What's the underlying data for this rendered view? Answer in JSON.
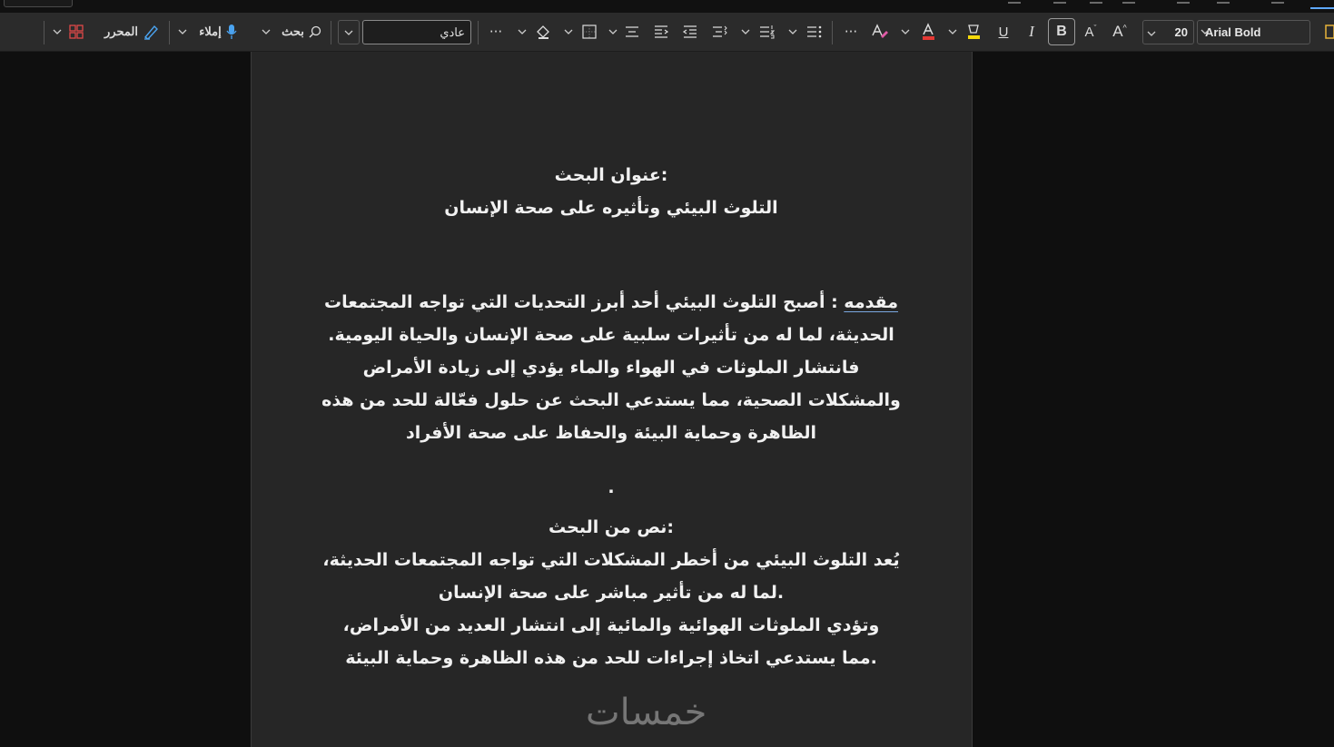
{
  "ribbon": {
    "font_name": "Arial Bold",
    "font_size": "20",
    "bold_label": "B",
    "italic_label": "I",
    "underline_label": "U",
    "style_value": "عادي",
    "search_label": "بحث",
    "dictate_label": "إملاء",
    "editor_label": "المحرر",
    "more_label": "···",
    "font_color": "#e53935",
    "highlight_color": "#f5d90a",
    "accent_color": "#5fa8ff"
  },
  "document": {
    "title_label": ":عنوان البحث",
    "title": "التلوث البيئي وتأثيره على صحة الإنسان",
    "intro_heading": "مقدمه",
    "intro_colon": " : ",
    "intro_lines": [
      "أصبح التلوث البيئي أحد أبرز التحديات التي تواجه المجتمعات",
      "الحديثة، لما له من تأثيرات سلبية على صحة الإنسان والحياة اليومية.",
      "فانتشار الملوثات في الهواء والماء يؤدي إلى زيادة الأمراض",
      "والمشكلات الصحية، مما يستدعي البحث عن حلول فعّالة للحد من هذه",
      "الظاهرة وحماية البيئة والحفاظ على صحة الأفراد"
    ],
    "dot": ".",
    "body_heading": ":نص من البحث",
    "body_lines": [
      "يُعد التلوث البيئي من أخطر المشكلات التي تواجه المجتمعات الحديثة،",
      ".لما له من تأثير مباشر على صحة الإنسان",
      "وتؤدي الملوثات الهوائية والمائية إلى انتشار العديد من الأمراض،",
      ".مما يستدعي اتخاذ إجراءات للحد من هذه الظاهرة وحماية البيئة"
    ]
  },
  "watermark": "خمسات"
}
